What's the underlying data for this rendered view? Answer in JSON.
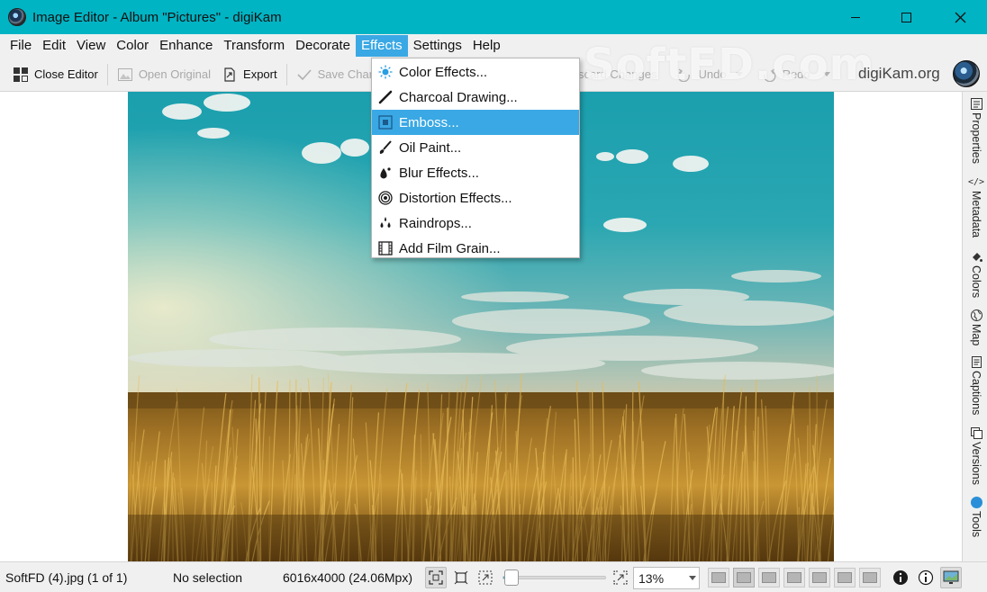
{
  "window": {
    "title": "Image Editor - Album \"Pictures\" - digiKam",
    "controls": [
      "minimize",
      "maximize",
      "close"
    ]
  },
  "menubar": {
    "items": [
      {
        "label": "File"
      },
      {
        "label": "Edit"
      },
      {
        "label": "View"
      },
      {
        "label": "Color"
      },
      {
        "label": "Enhance"
      },
      {
        "label": "Transform"
      },
      {
        "label": "Decorate"
      },
      {
        "label": "Effects",
        "active": true
      },
      {
        "label": "Settings"
      },
      {
        "label": "Help"
      }
    ]
  },
  "toolbar": {
    "close_editor": "Close Editor",
    "open_original": "Open Original",
    "export": "Export",
    "save_changes": "Save Char",
    "discard_changes": "scard Changes",
    "undo": "Undo",
    "redo": "Redo",
    "brand_text": "digiKam.org",
    "watermark": "SoftFD.com"
  },
  "effects_menu": {
    "items": [
      {
        "label": "Color Effects...",
        "icon": "color-effects-icon"
      },
      {
        "label": "Charcoal Drawing...",
        "icon": "charcoal-icon"
      },
      {
        "label": "Emboss...",
        "icon": "emboss-icon",
        "highlighted": true
      },
      {
        "label": "Oil Paint...",
        "icon": "oil-paint-icon"
      },
      {
        "label": "Blur Effects...",
        "icon": "blur-icon"
      },
      {
        "label": "Distortion Effects...",
        "icon": "distortion-icon"
      },
      {
        "label": "Raindrops...",
        "icon": "raindrops-icon"
      },
      {
        "label": "Add Film Grain...",
        "icon": "film-grain-icon"
      }
    ]
  },
  "right_sidebar": {
    "tabs": [
      {
        "label": "Properties",
        "icon": "properties-icon"
      },
      {
        "label": "Metadata",
        "icon": "code-icon"
      },
      {
        "label": "Colors",
        "icon": "paint-bucket-icon"
      },
      {
        "label": "Map",
        "icon": "globe-icon"
      },
      {
        "label": "Captions",
        "icon": "captions-icon"
      },
      {
        "label": "Versions",
        "icon": "versions-icon"
      },
      {
        "label": "Tools",
        "icon": "tools-icon"
      }
    ]
  },
  "statusbar": {
    "filename": "SoftFD (4).jpg (1 of 1)",
    "selection": "No selection",
    "dimensions": "6016x4000 (24.06Mpx)",
    "zoom": "13%",
    "zoom_slider_fraction": 0.09
  },
  "colors": {
    "titlebar": "#00b4c4",
    "highlight": "#3aa8e4"
  }
}
